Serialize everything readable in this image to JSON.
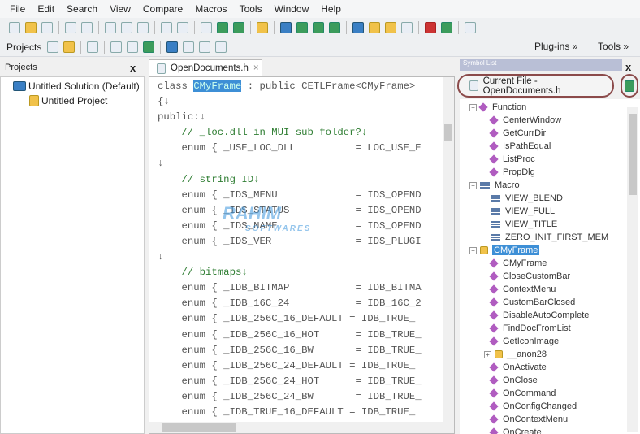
{
  "menu": [
    "File",
    "Edit",
    "Search",
    "View",
    "Compare",
    "Macros",
    "Tools",
    "Window",
    "Help"
  ],
  "toolbar2": {
    "projects_label": "Projects",
    "plugins_label": "Plug-ins »",
    "tools_label": "Tools »"
  },
  "projects_panel": {
    "title": "Projects",
    "close": "x",
    "solution": "Untitled Solution (Default)",
    "project": "Untitled Project"
  },
  "editor": {
    "tab_label": "OpenDocuments.h",
    "tab_close": "×",
    "lines": [
      {
        "pre": "class ",
        "sel": "CMyFrame",
        "post": " : public CETLFrame<CMyFrame>"
      },
      {
        "pre": "{↓"
      },
      {
        "pre": "public:↓"
      },
      {
        "pre": "    ",
        "cm": "// _loc.dll in MUI sub folder?↓"
      },
      {
        "pre": "    enum { _USE_LOC_DLL          = LOC_USE_E"
      },
      {
        "pre": "↓"
      },
      {
        "pre": "    ",
        "cm": "// string ID↓"
      },
      {
        "pre": "    enum { _IDS_MENU             = IDS_OPEND"
      },
      {
        "pre": "    enum { _IDS_STATUS           = IDS_OPEND"
      },
      {
        "pre": "    enum { _IDS_NAME             = IDS_OPEND"
      },
      {
        "pre": "    enum { _IDS_VER              = IDS_PLUGI"
      },
      {
        "pre": "↓"
      },
      {
        "pre": "    ",
        "cm": "// bitmaps↓"
      },
      {
        "pre": "    enum { _IDB_BITMAP           = IDB_BITMA"
      },
      {
        "pre": "    enum { _IDB_16C_24           = IDB_16C_2"
      },
      {
        "pre": "    enum { _IDB_256C_16_DEFAULT = IDB_TRUE_"
      },
      {
        "pre": "    enum { _IDB_256C_16_HOT      = IDB_TRUE_"
      },
      {
        "pre": "    enum { _IDB_256C_16_BW       = IDB_TRUE_"
      },
      {
        "pre": "    enum { _IDB_256C_24_DEFAULT = IDB_TRUE_"
      },
      {
        "pre": "    enum { _IDB_256C_24_HOT      = IDB_TRUE_"
      },
      {
        "pre": "    enum { _IDB_256C_24_BW       = IDB_TRUE_"
      },
      {
        "pre": "    enum { _IDB_TRUE_16_DEFAULT = IDB_TRUE_"
      }
    ]
  },
  "watermark": {
    "line1": "RAHIM",
    "line2": "SOFTWARES"
  },
  "symbol_list": {
    "title": "Symbol List",
    "close": "x",
    "file_selector": "Current File - OpenDocuments.h",
    "tree": [
      {
        "label": "Function",
        "kind": "group",
        "level": 0
      },
      {
        "label": "CenterWindow",
        "kind": "func",
        "level": 1
      },
      {
        "label": "GetCurrDir",
        "kind": "func",
        "level": 1
      },
      {
        "label": "IsPathEqual",
        "kind": "func",
        "level": 1
      },
      {
        "label": "ListProc",
        "kind": "func",
        "level": 1
      },
      {
        "label": "PropDlg",
        "kind": "func",
        "level": 1
      },
      {
        "label": "Macro",
        "kind": "macgroup",
        "level": 0
      },
      {
        "label": "VIEW_BLEND",
        "kind": "macro",
        "level": 1
      },
      {
        "label": "VIEW_FULL",
        "kind": "macro",
        "level": 1
      },
      {
        "label": "VIEW_TITLE",
        "kind": "macro",
        "level": 1
      },
      {
        "label": "ZERO_INIT_FIRST_MEM",
        "kind": "macro",
        "level": 1
      },
      {
        "label": "CMyFrame",
        "kind": "class",
        "level": 0
      },
      {
        "label": "CMyFrame",
        "kind": "func",
        "level": 1
      },
      {
        "label": "CloseCustomBar",
        "kind": "func",
        "level": 1
      },
      {
        "label": "ContextMenu",
        "kind": "func",
        "level": 1
      },
      {
        "label": "CustomBarClosed",
        "kind": "func",
        "level": 1
      },
      {
        "label": "DisableAutoComplete",
        "kind": "func",
        "level": 1
      },
      {
        "label": "FindDocFromList",
        "kind": "func",
        "level": 1
      },
      {
        "label": "GetIconImage",
        "kind": "func",
        "level": 1
      },
      {
        "label": "__anon28",
        "kind": "anon",
        "level": 1
      },
      {
        "label": "OnActivate",
        "kind": "func",
        "level": 1
      },
      {
        "label": "OnClose",
        "kind": "func",
        "level": 1
      },
      {
        "label": "OnCommand",
        "kind": "func",
        "level": 1
      },
      {
        "label": "OnConfigChanged",
        "kind": "func",
        "level": 1
      },
      {
        "label": "OnContextMenu",
        "kind": "func",
        "level": 1
      },
      {
        "label": "OnCreate",
        "kind": "func",
        "level": 1
      }
    ]
  }
}
